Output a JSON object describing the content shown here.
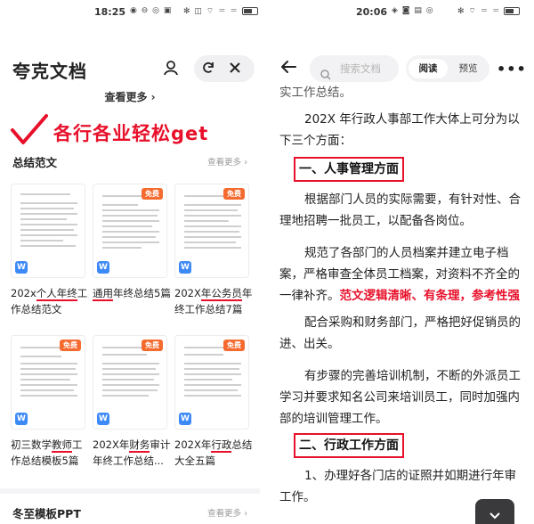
{
  "left": {
    "status_time": "18:25",
    "app_title": "夸克文档",
    "see_more_top": "查看更多 ›",
    "promo": "各行各业轻松get",
    "summary_section": {
      "title": "总结范文",
      "more": "查看更多 ›"
    },
    "free_badge": "免费",
    "word_badge": "W",
    "cards_row1": [
      {
        "title_a": "202x",
        "title_b": "个人年终",
        "title_c": "工作总结范文",
        "ul": "个人年终"
      },
      {
        "title_a": "",
        "title_b": "通用",
        "title_c": "年终总结5篇",
        "ul": "通用"
      },
      {
        "title_a": "202X",
        "title_b": "年公务员",
        "title_c": "年终工作总结7篇",
        "ul": "年公务员"
      }
    ],
    "cards_row2": [
      {
        "line1_pre": "初三数学",
        "line1_ul": "教师",
        "line1_post": "工",
        "line2": "作总结模板5篇"
      },
      {
        "line1_pre": "202X年",
        "line1_ul": "财务",
        "line1_post": "审计",
        "line2": "年终工作总结..."
      },
      {
        "line1_pre": "202X年",
        "line1_ul": "行政",
        "line1_post": "总结",
        "line2": "大全五篇"
      }
    ],
    "ppt_section": {
      "title": "冬至模板PPT",
      "more": "查看更多 ›"
    }
  },
  "right": {
    "status_time": "20:06",
    "search_placeholder": "搜索文档",
    "tab_read": "阅读",
    "tab_preview": "预览",
    "menu": "•••",
    "top_cut": "实工作总结。",
    "p1": "202X 年行政人事部工作大体上可分为以下三个方面：",
    "h1": "一、人事管理方面",
    "p2": "根据部门人员的实际需要，有针对性、合理地招聘一批员工，以配备各岗位。",
    "p3": "规范了各部门的人员档案并建立电子档案，严格审查全体员工档案，对资料不齐全的一律补齐。",
    "p3_red": "范文逻辑清晰、有条理，参考性强",
    "p4": "配合采购和财务部门，严格把好促销员的进、出关。",
    "p5": "有步骤的完善培训机制，不断的外派员工学习并要求知名公司来培训员工，同时加强内部的培训管理工作。",
    "h2": "二、行政工作方面",
    "p6": "1、办理好各门店的证照并如期进行年审工作。"
  }
}
